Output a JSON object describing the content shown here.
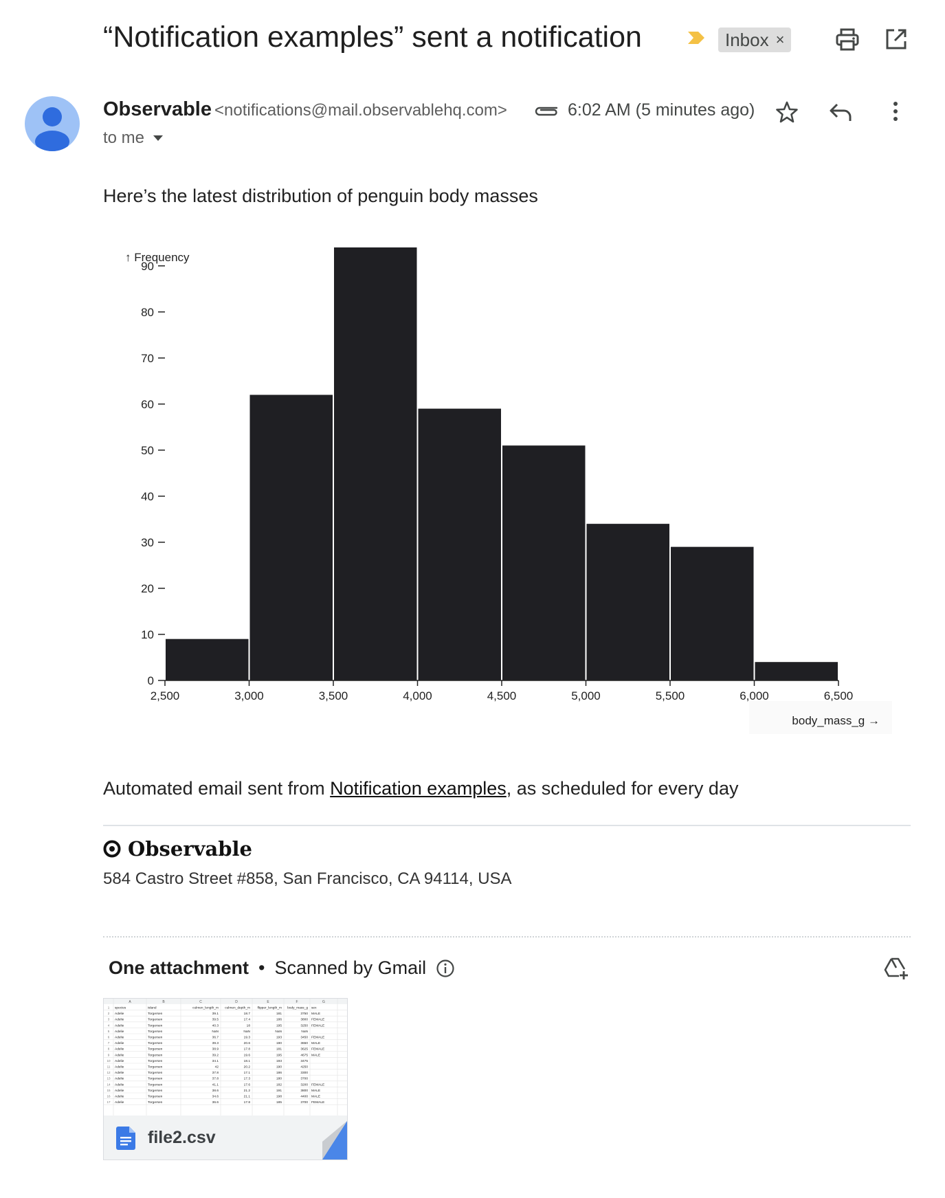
{
  "header": {
    "subject": "“Notification examples” sent a notification",
    "label": "Inbox",
    "label_close": "×"
  },
  "message": {
    "sender_name": "Observable",
    "sender_email": "<notifications@mail.observablehq.com>",
    "time": "6:02 AM (5 minutes ago)",
    "recipient": "to me",
    "intro": "Here’s the latest distribution of penguin body masses",
    "footer_prefix": "Automated email sent from ",
    "footer_link": "Notification examples",
    "footer_suffix": ", as scheduled for every day",
    "brand": "Observable",
    "address": "584 Castro Street #858, San Francisco, CA 94114, USA"
  },
  "attachments": {
    "count_label": "One attachment",
    "separator": "•",
    "scanned_label": "Scanned by Gmail",
    "file_name": "file2.csv",
    "preview": {
      "columns": [
        "A",
        "B",
        "C",
        "D",
        "E",
        "F",
        "G"
      ],
      "rows": [
        [
          "species",
          "island",
          "culmen_length_m",
          "culmen_depth_m",
          "flipper_length_m",
          "body_mass_g",
          "sex"
        ],
        [
          "Adelie",
          "Torgersen",
          "39.1",
          "18.7",
          "181",
          "3750",
          "MALE"
        ],
        [
          "Adelie",
          "Torgersen",
          "39.5",
          "17.4",
          "186",
          "3800",
          "FEMALE"
        ],
        [
          "Adelie",
          "Torgersen",
          "40.3",
          "18",
          "195",
          "3250",
          "FEMALE"
        ],
        [
          "Adelie",
          "Torgersen",
          "NaN",
          "NaN",
          "NaN",
          "NaN",
          ""
        ],
        [
          "Adelie",
          "Torgersen",
          "36.7",
          "19.3",
          "193",
          "3450",
          "FEMALE"
        ],
        [
          "Adelie",
          "Torgersen",
          "39.3",
          "20.6",
          "190",
          "3650",
          "MALE"
        ],
        [
          "Adelie",
          "Torgersen",
          "38.9",
          "17.8",
          "181",
          "3625",
          "FEMALE"
        ],
        [
          "Adelie",
          "Torgersen",
          "39.2",
          "19.6",
          "195",
          "4675",
          "MALE"
        ],
        [
          "Adelie",
          "Torgersen",
          "34.1",
          "18.1",
          "193",
          "3475",
          ""
        ],
        [
          "Adelie",
          "Torgersen",
          "42",
          "20.2",
          "190",
          "4250",
          ""
        ],
        [
          "Adelie",
          "Torgersen",
          "37.8",
          "17.1",
          "186",
          "3300",
          ""
        ],
        [
          "Adelie",
          "Torgersen",
          "37.8",
          "17.3",
          "180",
          "3700",
          ""
        ],
        [
          "Adelie",
          "Torgersen",
          "41.1",
          "17.6",
          "182",
          "3200",
          "FEMALE"
        ],
        [
          "Adelie",
          "Torgersen",
          "38.6",
          "21.2",
          "191",
          "3800",
          "MALE"
        ],
        [
          "Adelie",
          "Torgersen",
          "34.6",
          "21.1",
          "198",
          "4400",
          "MALE"
        ],
        [
          "Adelie",
          "Torgersen",
          "36.6",
          "17.8",
          "185",
          "3700",
          "FEMALE"
        ]
      ]
    }
  },
  "icons": {
    "importance": "importance-marker-icon",
    "print": "print-icon",
    "popout": "open-in-new-window-icon",
    "attachment": "paperclip-icon",
    "star": "star-icon",
    "reply": "reply-icon",
    "more": "more-vertical-icon",
    "dropdown": "caret-down-icon",
    "info": "info-icon",
    "drive_add": "add-to-drive-icon",
    "file": "docs-file-icon"
  },
  "colors": {
    "importance": "#f4c145",
    "avatar_bg": "#9ec2f6",
    "avatar_fg": "#2f6cde",
    "bars": "#1f1f23",
    "file_icon": "#3b7ae6"
  },
  "chart_data": {
    "type": "bar",
    "bins": [
      {
        "x0": 2500,
        "x1": 3000,
        "value": 9
      },
      {
        "x0": 3000,
        "x1": 3500,
        "value": 62
      },
      {
        "x0": 3500,
        "x1": 4000,
        "value": 94
      },
      {
        "x0": 4000,
        "x1": 4500,
        "value": 59
      },
      {
        "x0": 4500,
        "x1": 5000,
        "value": 51
      },
      {
        "x0": 5000,
        "x1": 5500,
        "value": 34
      },
      {
        "x0": 5500,
        "x1": 6000,
        "value": 29
      },
      {
        "x0": 6000,
        "x1": 6500,
        "value": 4
      }
    ],
    "xlabel": "body_mass_g →",
    "ylabel": "↑ Frequency",
    "xlim": [
      2500,
      6500
    ],
    "ylim": [
      0,
      94
    ],
    "xticks": [
      2500,
      3000,
      3500,
      4000,
      4500,
      5000,
      5500,
      6000,
      6500
    ],
    "xtick_labels": [
      "2,500",
      "3,000",
      "3,500",
      "4,000",
      "4,500",
      "5,000",
      "5,500",
      "6,000",
      "6,500"
    ],
    "yticks": [
      0,
      10,
      20,
      30,
      40,
      50,
      60,
      70,
      80,
      90
    ],
    "grid": false
  }
}
